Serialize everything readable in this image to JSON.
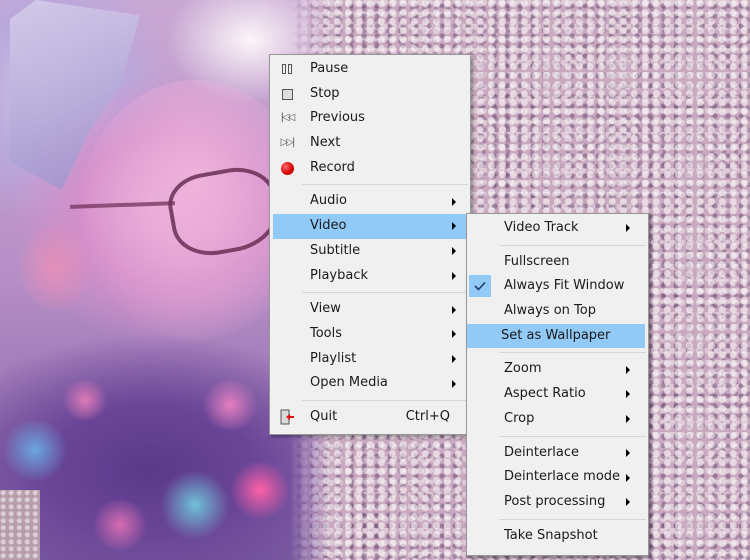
{
  "background": {
    "description": "video frame: child with hair bow and glasses on gravel ground",
    "highlight_color": "#91c9f7",
    "menu_bg": "#f0f0f0"
  },
  "main_menu": {
    "groups": [
      [
        {
          "label": "Pause",
          "icon": "pause-icon"
        },
        {
          "label": "Stop",
          "icon": "stop-icon"
        },
        {
          "label": "Previous",
          "icon": "previous-icon"
        },
        {
          "label": "Next",
          "icon": "next-icon"
        },
        {
          "label": "Record",
          "icon": "record-icon"
        }
      ],
      [
        {
          "label": "Audio",
          "submenu": true
        },
        {
          "label": "Video",
          "submenu": true,
          "highlighted": true
        },
        {
          "label": "Subtitle",
          "submenu": true
        },
        {
          "label": "Playback",
          "submenu": true
        }
      ],
      [
        {
          "label": "View",
          "submenu": true
        },
        {
          "label": "Tools",
          "submenu": true
        },
        {
          "label": "Playlist",
          "submenu": true
        },
        {
          "label": "Open Media",
          "submenu": true
        }
      ],
      [
        {
          "label": "Quit",
          "icon": "quit-icon",
          "shortcut": "Ctrl+Q"
        }
      ]
    ]
  },
  "video_submenu": {
    "groups": [
      [
        {
          "label": "Video Track",
          "submenu": true
        }
      ],
      [
        {
          "label": "Fullscreen"
        },
        {
          "label": "Always Fit Window",
          "checked": true
        },
        {
          "label": "Always on Top"
        },
        {
          "label": "Set as Wallpaper",
          "highlighted": true
        }
      ],
      [
        {
          "label": "Zoom",
          "submenu": true
        },
        {
          "label": "Aspect Ratio",
          "submenu": true
        },
        {
          "label": "Crop",
          "submenu": true
        }
      ],
      [
        {
          "label": "Deinterlace",
          "submenu": true
        },
        {
          "label": "Deinterlace mode",
          "submenu": true
        },
        {
          "label": "Post processing",
          "submenu": true
        }
      ],
      [
        {
          "label": "Take Snapshot"
        }
      ]
    ]
  }
}
